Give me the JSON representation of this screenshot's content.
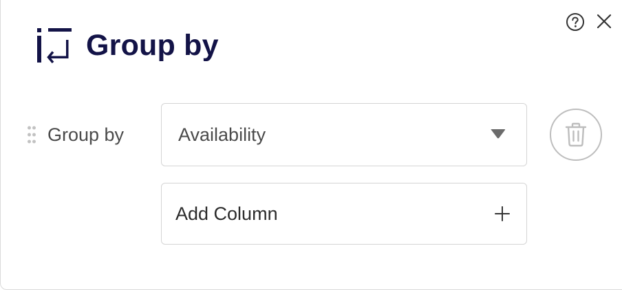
{
  "dialog": {
    "title": "Group by",
    "title_color": "#131347",
    "icons": {
      "header": "group-by-icon",
      "help": "help-circle-icon",
      "close": "close-icon"
    }
  },
  "group_rows": [
    {
      "label": "Group by",
      "selected_value": "Availability",
      "handle_icon": "drag-handle-icon",
      "dropdown_icon": "caret-down-icon",
      "delete_icon": "trash-icon"
    }
  ],
  "add_column": {
    "label": "Add Column",
    "icon": "plus-icon"
  }
}
